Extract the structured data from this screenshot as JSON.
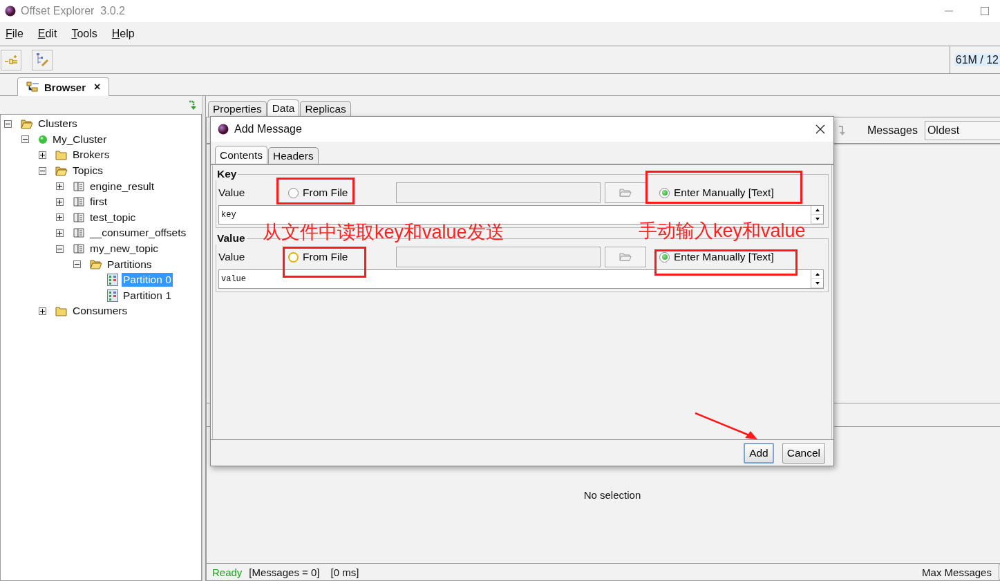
{
  "window": {
    "title": "Offset Explorer  3.0.2"
  },
  "menu": [
    "File",
    "Edit",
    "Tools",
    "Help"
  ],
  "memory": "61M / 12",
  "browser_tab": {
    "label": "Browser",
    "close": "×"
  },
  "tree": [
    {
      "label": "Clusters",
      "kind": "folder",
      "expanded": true,
      "selected": false,
      "children": [
        {
          "label": "My_Cluster",
          "kind": "cluster",
          "expanded": true,
          "selected": false,
          "children": [
            {
              "label": "Brokers",
              "kind": "folder",
              "expanded": false,
              "selected": false
            },
            {
              "label": "Topics",
              "kind": "folder",
              "expanded": true,
              "selected": false,
              "children": [
                {
                  "label": "engine_result",
                  "kind": "topic",
                  "expanded": false,
                  "selected": false
                },
                {
                  "label": "first",
                  "kind": "topic",
                  "expanded": false,
                  "selected": false
                },
                {
                  "label": "test_topic",
                  "kind": "topic",
                  "expanded": false,
                  "selected": false
                },
                {
                  "label": "__consumer_offsets",
                  "kind": "topic",
                  "expanded": false,
                  "selected": false
                },
                {
                  "label": "my_new_topic",
                  "kind": "topic",
                  "expanded": true,
                  "selected": false,
                  "children": [
                    {
                      "label": "Partitions",
                      "kind": "folder",
                      "expanded": true,
                      "selected": false,
                      "children": [
                        {
                          "label": "Partition 0",
                          "kind": "partition",
                          "selected": true
                        },
                        {
                          "label": "Partition 1",
                          "kind": "partition",
                          "selected": false
                        }
                      ]
                    }
                  ]
                }
              ]
            },
            {
              "label": "Consumers",
              "kind": "folder",
              "expanded": false,
              "selected": false
            }
          ]
        }
      ]
    }
  ],
  "detail_tabs": [
    {
      "label": "Properties",
      "selected": false
    },
    {
      "label": "Data",
      "selected": true
    },
    {
      "label": "Replicas",
      "selected": false
    }
  ],
  "messages": {
    "label": "Messages",
    "value": "Oldest"
  },
  "empty_text": "No selection",
  "status": {
    "state": "Ready",
    "messages": "[Messages = 0]",
    "time": "[0 ms]",
    "max_label": "Max Messages"
  },
  "dialog": {
    "title": "Add Message",
    "tabs": [
      {
        "label": "Contents",
        "selected": true
      },
      {
        "label": "Headers",
        "selected": false
      }
    ],
    "sections": [
      {
        "title": "Key",
        "label": "Value",
        "options": [
          {
            "label": "From File",
            "selected": false,
            "focused": false
          },
          {
            "label": "Enter Manually [Text]",
            "selected": true,
            "focused": false
          }
        ],
        "text": "key"
      },
      {
        "title": "Value",
        "label": "Value",
        "options": [
          {
            "label": "From File",
            "selected": false,
            "focused": true
          },
          {
            "label": "Enter Manually [Text]",
            "selected": true,
            "focused": false
          }
        ],
        "text": "value"
      }
    ],
    "buttons": [
      {
        "label": "Add",
        "default": true
      },
      {
        "label": "Cancel",
        "default": false
      }
    ]
  },
  "annotations": [
    {
      "text": "从文件中读取key和value发送"
    },
    {
      "text": "手动输入key和value"
    }
  ]
}
